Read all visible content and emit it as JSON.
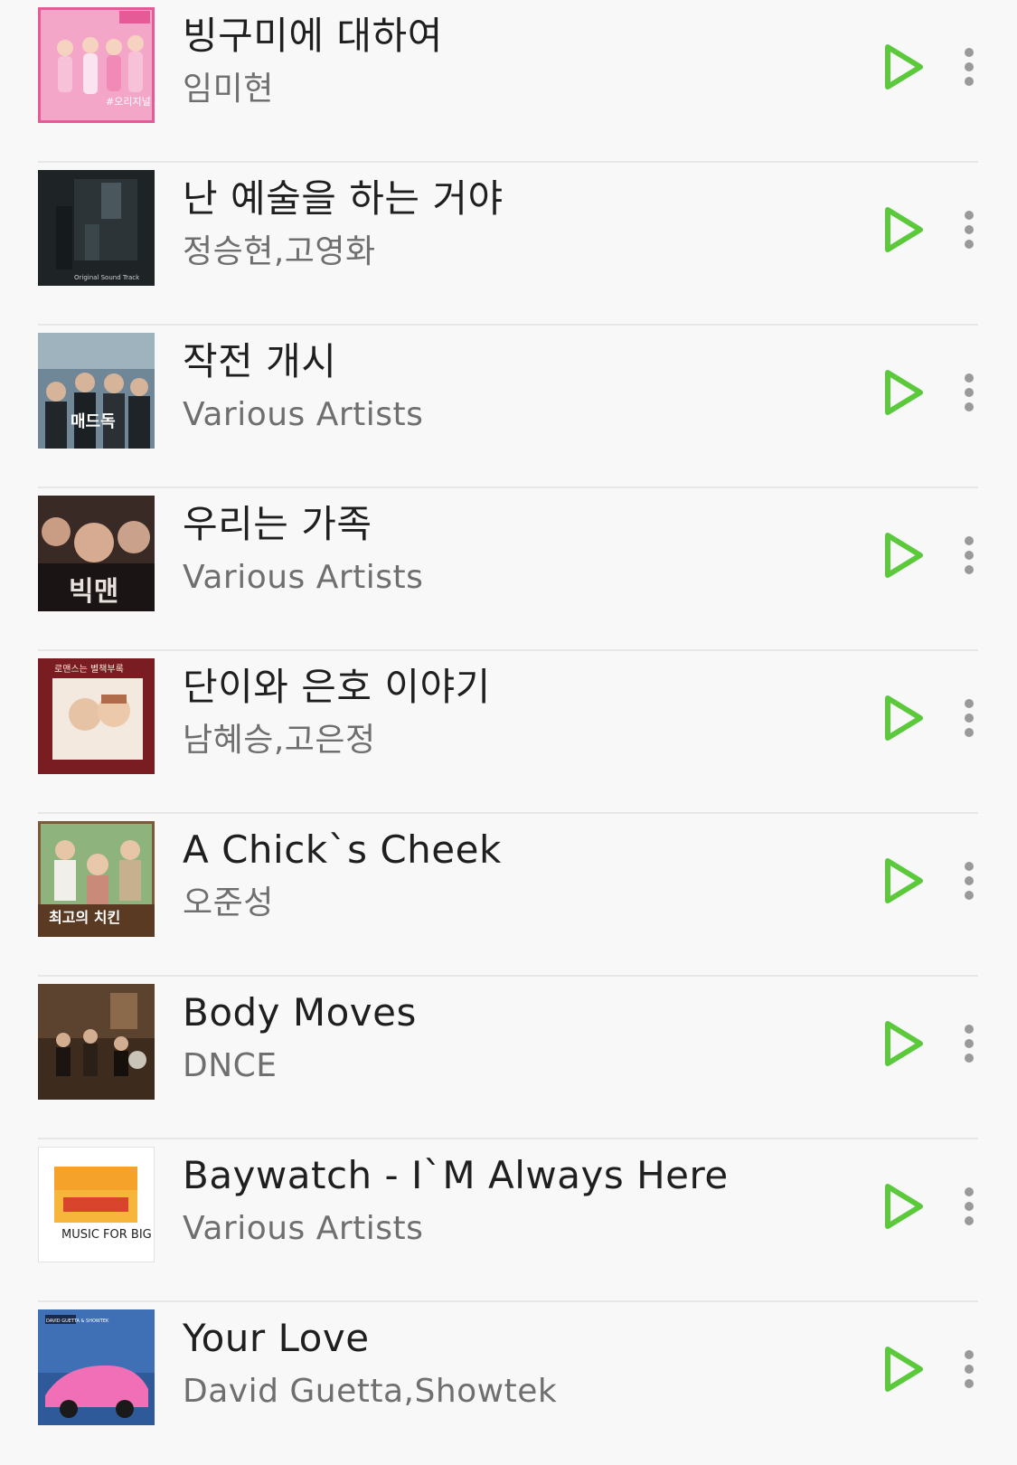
{
  "accent_color": "#5cc93c",
  "songs": [
    {
      "title": "빙구미에 대하여",
      "artist": "임미현",
      "cover_icon": "album-cover",
      "cover_text": "#오리지널 사운드트랙"
    },
    {
      "title": "난 예술을 하는 거야",
      "artist": "정승현,고영화",
      "cover_icon": "album-cover",
      "cover_text": "Original Sound Track"
    },
    {
      "title": "작전 개시",
      "artist": "Various Artists",
      "cover_icon": "album-cover",
      "cover_text": "매드독"
    },
    {
      "title": "우리는 가족",
      "artist": "Various Artists",
      "cover_icon": "album-cover",
      "cover_text": "빅맨"
    },
    {
      "title": "단이와 은호 이야기",
      "artist": "남혜승,고은정",
      "cover_icon": "album-cover",
      "cover_text": "로맨스는 별책부록"
    },
    {
      "title": "A Chick`s Cheek",
      "artist": "오준성",
      "cover_icon": "album-cover",
      "cover_text": "최고의 치킨"
    },
    {
      "title": "Body Moves",
      "artist": "DNCE",
      "cover_icon": "album-cover",
      "cover_text": ""
    },
    {
      "title": "Baywatch - I`M Always Here",
      "artist": "Various Artists",
      "cover_icon": "album-cover",
      "cover_text": "MUSIC FOR BIG KIDS"
    },
    {
      "title": "Your Love",
      "artist": "David Guetta,Showtek",
      "cover_icon": "album-cover",
      "cover_text": "DAVID GUETTA & SHOWTEK"
    }
  ],
  "icons": {
    "play": "play-icon",
    "more": "more-vertical-icon"
  }
}
